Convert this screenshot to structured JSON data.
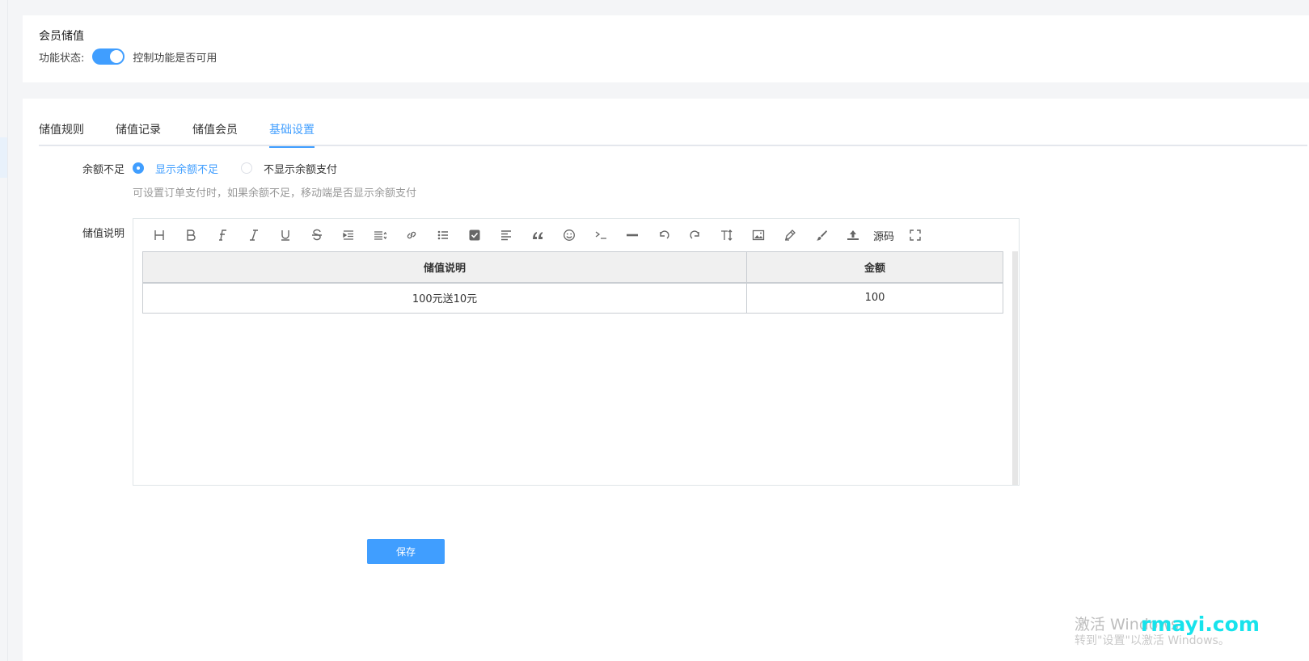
{
  "header": {
    "title": "会员储值",
    "status_label": "功能状态:",
    "status_on": true,
    "status_hint": "控制功能是否可用"
  },
  "tabs": [
    {
      "label": "储值规则",
      "active": false
    },
    {
      "label": "储值记录",
      "active": false
    },
    {
      "label": "储值会员",
      "active": false
    },
    {
      "label": "基础设置",
      "active": true
    }
  ],
  "form": {
    "balance_label": "余额不足",
    "options": [
      {
        "label": "显示余额不足",
        "checked": true
      },
      {
        "label": "不显示余额支付",
        "checked": false
      }
    ],
    "hint": "可设置订单支付时，如果余额不足，移动端是否显示余额支付",
    "desc_label": "储值说明"
  },
  "editor": {
    "toolbar": [
      "heading-icon",
      "bold-icon",
      "font-icon",
      "italic-icon",
      "underline-icon",
      "strikethrough-icon",
      "indent-icon",
      "line-height-icon",
      "link-icon",
      "list-icon",
      "checkbox-icon",
      "align-left-icon",
      "quote-icon",
      "emoji-icon",
      "code-icon",
      "hr-icon",
      "undo-icon",
      "redo-icon",
      "font-size-icon",
      "image-icon",
      "pen-icon",
      "brush-icon",
      "upload-icon",
      "source-code",
      "fullscreen-icon"
    ],
    "source_label": "源码",
    "table": {
      "headers": [
        "储值说明",
        "金额"
      ],
      "rows": [
        [
          "100元送10元",
          "100"
        ]
      ]
    }
  },
  "save_label": "保存",
  "watermark": {
    "line1": "激活 Windows",
    "line2": "转到\"设置\"以激活 Windows。",
    "site": "rmayi.com"
  },
  "colors": {
    "accent": "#409eff",
    "watermark_site": "#17e3ec"
  }
}
